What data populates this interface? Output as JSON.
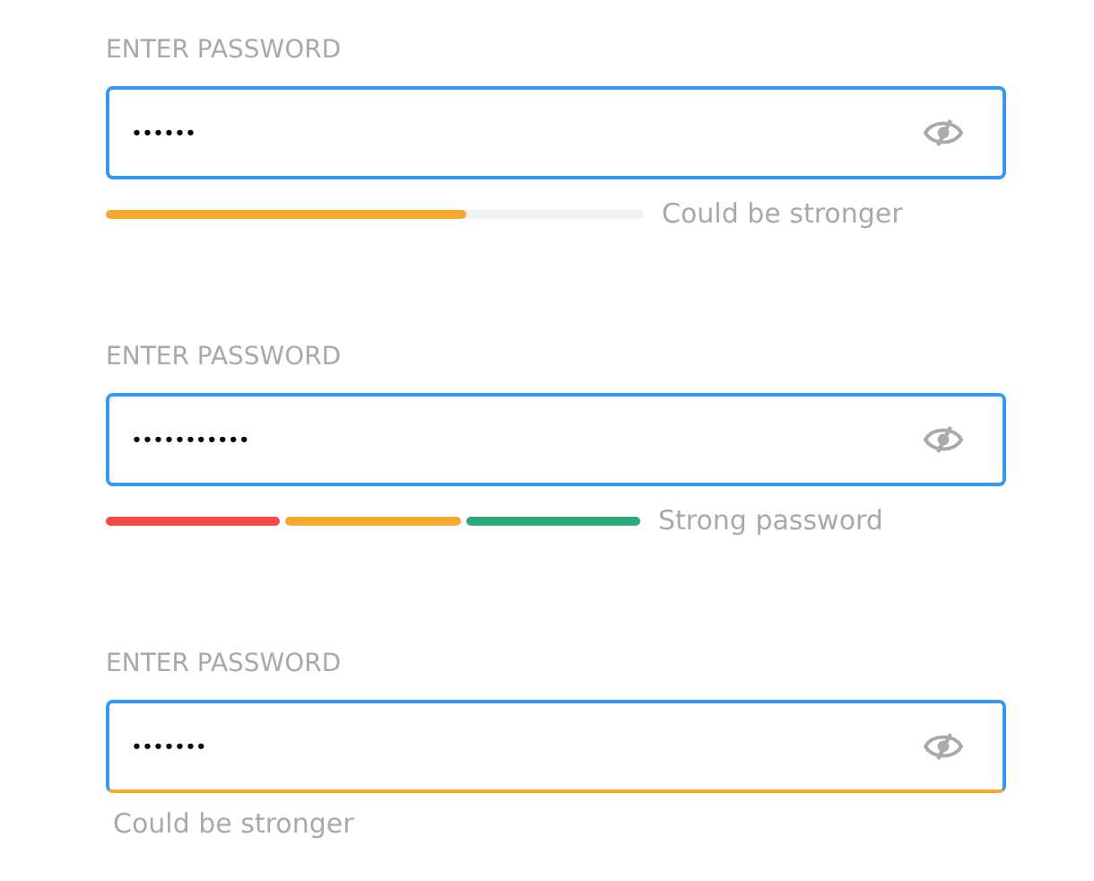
{
  "fields": [
    {
      "kind": "bar",
      "label": "ENTER PASSWORD",
      "value": "••••••",
      "strength_text": "Could be stronger",
      "level": 0.67,
      "color": "#f5a92e"
    },
    {
      "kind": "segments",
      "label": "ENTER PASSWORD",
      "value": "•••••••••••",
      "strength_text": "Strong password",
      "segments": [
        {
          "color": "#f34a4a"
        },
        {
          "color": "#f5a92e"
        },
        {
          "color": "#2bab7a"
        }
      ]
    },
    {
      "kind": "underline",
      "label": "ENTER PASSWORD",
      "value": "•••••••",
      "strength_text": "Could be stronger",
      "color": "#f5a92e"
    }
  ]
}
